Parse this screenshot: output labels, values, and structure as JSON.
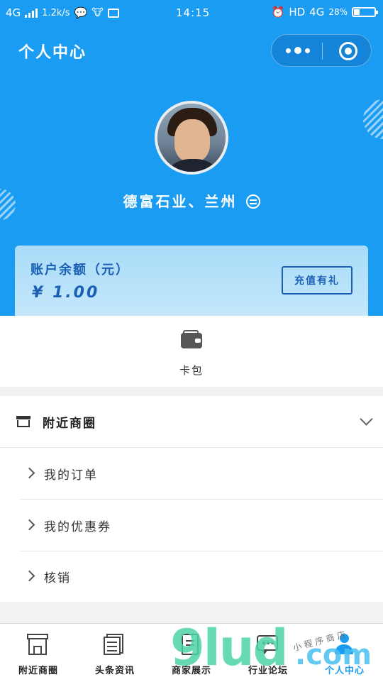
{
  "status_bar": {
    "network_left": "4G",
    "speed": "1.2k/s",
    "time": "14:15",
    "hd": "HD",
    "network_right": "4G",
    "battery": "28%",
    "battery_level": 0.28
  },
  "nav": {
    "title": "个人中心"
  },
  "profile": {
    "name": "德富石业、兰州"
  },
  "balance": {
    "label": "账户余额（元）",
    "amount": "¥ 1.00",
    "recharge_button": "充值有礼"
  },
  "card_pack": {
    "label": "卡包"
  },
  "menu": {
    "section_title": "附近商圈",
    "items": [
      {
        "label": "我的订单"
      },
      {
        "label": "我的优惠券"
      },
      {
        "label": "核销"
      }
    ]
  },
  "tabbar": {
    "tabs": [
      {
        "label": "附近商圈",
        "icon": "store-icon"
      },
      {
        "label": "头条资讯",
        "icon": "news-icon"
      },
      {
        "label": "商家展示",
        "icon": "showcase-icon"
      },
      {
        "label": "行业论坛",
        "icon": "forum-icon"
      },
      {
        "label": "个人中心",
        "icon": "user-icon"
      }
    ],
    "active_index": 4
  },
  "watermark": {
    "main": "9lud",
    "domain": ".com",
    "caption": "小程序商店"
  },
  "colors": {
    "primary": "#1a9cf2",
    "balance_text": "#1b5fb5"
  }
}
